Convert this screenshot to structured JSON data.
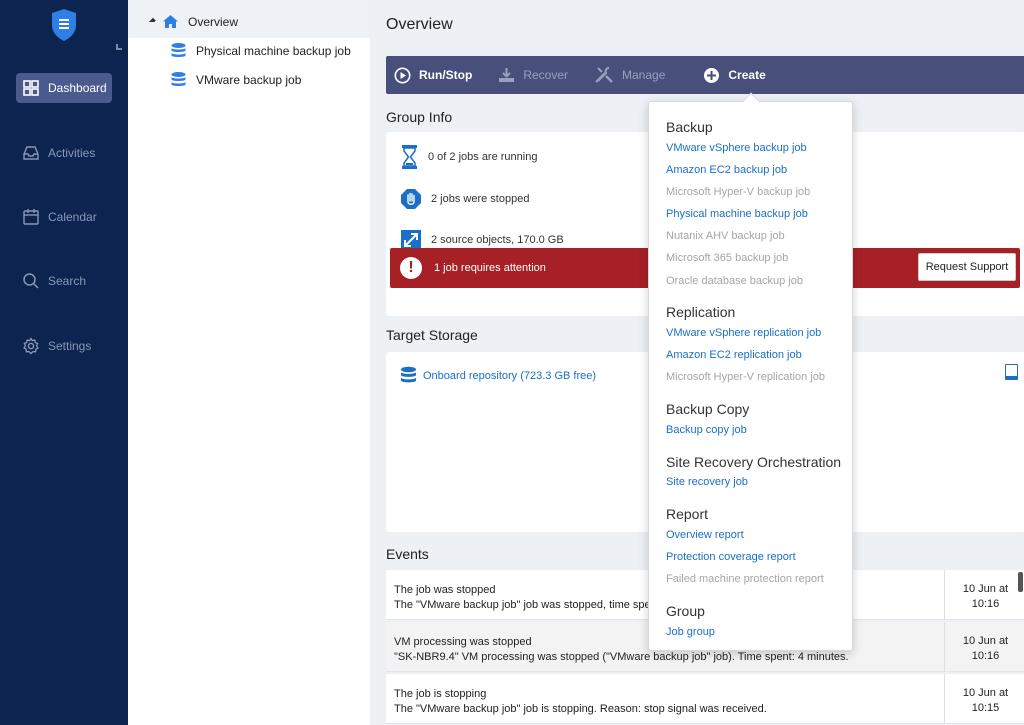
{
  "nav": {
    "items": [
      {
        "label": "Dashboard",
        "icon": "dashboard-icon"
      },
      {
        "label": "Activities",
        "icon": "inbox-icon"
      },
      {
        "label": "Calendar",
        "icon": "calendar-icon"
      },
      {
        "label": "Search",
        "icon": "search-icon"
      },
      {
        "label": "Settings",
        "icon": "gear-icon"
      }
    ]
  },
  "tree": {
    "root": "Overview",
    "children": [
      "Physical machine backup job",
      "VMware backup job"
    ]
  },
  "main": {
    "title": "Overview",
    "toolbar": {
      "run_stop": "Run/Stop",
      "recover": "Recover",
      "manage": "Manage",
      "create": "Create"
    },
    "group_info": {
      "heading": "Group Info",
      "running": "0 of 2 jobs are running",
      "stopped": "2 jobs were stopped",
      "sources": "2 source objects, 170.0 GB",
      "attention": "1 job requires attention",
      "request_support": "Request Support"
    },
    "target_storage": {
      "heading": "Target Storage",
      "repo": "Onboard repository (723.3 GB free)"
    },
    "events": {
      "heading": "Events",
      "rows": [
        {
          "title": "The job was stopped",
          "detail": "The \"VMware backup job\" job was stopped, time spent: 4 minutes.",
          "date": "10 Jun at",
          "time": "10:16"
        },
        {
          "title": "VM processing was stopped",
          "detail": "\"SK-NBR9.4\" VM processing was stopped (\"VMware backup job\" job). Time spent: 4 minutes.",
          "date": "10 Jun at",
          "time": "10:16"
        },
        {
          "title": "The job is stopping",
          "detail": "The \"VMware backup job\" job is stopping. Reason: stop signal was received.",
          "date": "10 Jun at",
          "time": "10:15"
        }
      ]
    }
  },
  "create_menu": {
    "backup": {
      "heading": "Backup",
      "items": [
        {
          "label": "VMware vSphere backup job",
          "enabled": true
        },
        {
          "label": "Amazon EC2 backup job",
          "enabled": true
        },
        {
          "label": "Microsoft Hyper-V backup job",
          "enabled": false
        },
        {
          "label": "Physical machine backup job",
          "enabled": true
        },
        {
          "label": "Nutanix AHV backup job",
          "enabled": false
        },
        {
          "label": "Microsoft 365 backup job",
          "enabled": false
        },
        {
          "label": "Oracle database backup job",
          "enabled": false
        }
      ]
    },
    "replication": {
      "heading": "Replication",
      "items": [
        {
          "label": "VMware vSphere replication job",
          "enabled": true
        },
        {
          "label": "Amazon EC2 replication job",
          "enabled": true
        },
        {
          "label": "Microsoft Hyper-V replication job",
          "enabled": false
        }
      ]
    },
    "backup_copy": {
      "heading": "Backup Copy",
      "items": [
        {
          "label": "Backup copy job",
          "enabled": true
        }
      ]
    },
    "site_recovery": {
      "heading": "Site Recovery Orchestration",
      "items": [
        {
          "label": "Site recovery job",
          "enabled": true
        }
      ]
    },
    "report": {
      "heading": "Report",
      "items": [
        {
          "label": "Overview report",
          "enabled": true
        },
        {
          "label": "Protection coverage report",
          "enabled": true
        },
        {
          "label": "Failed machine protection report",
          "enabled": false
        }
      ]
    },
    "group": {
      "heading": "Group",
      "items": [
        {
          "label": "Job group",
          "enabled": true
        }
      ]
    }
  },
  "colors": {
    "nav_bg": "#0d2350",
    "toolbar_bg": "#474f7a",
    "link": "#1a6fc7",
    "alert": "#a62025"
  }
}
